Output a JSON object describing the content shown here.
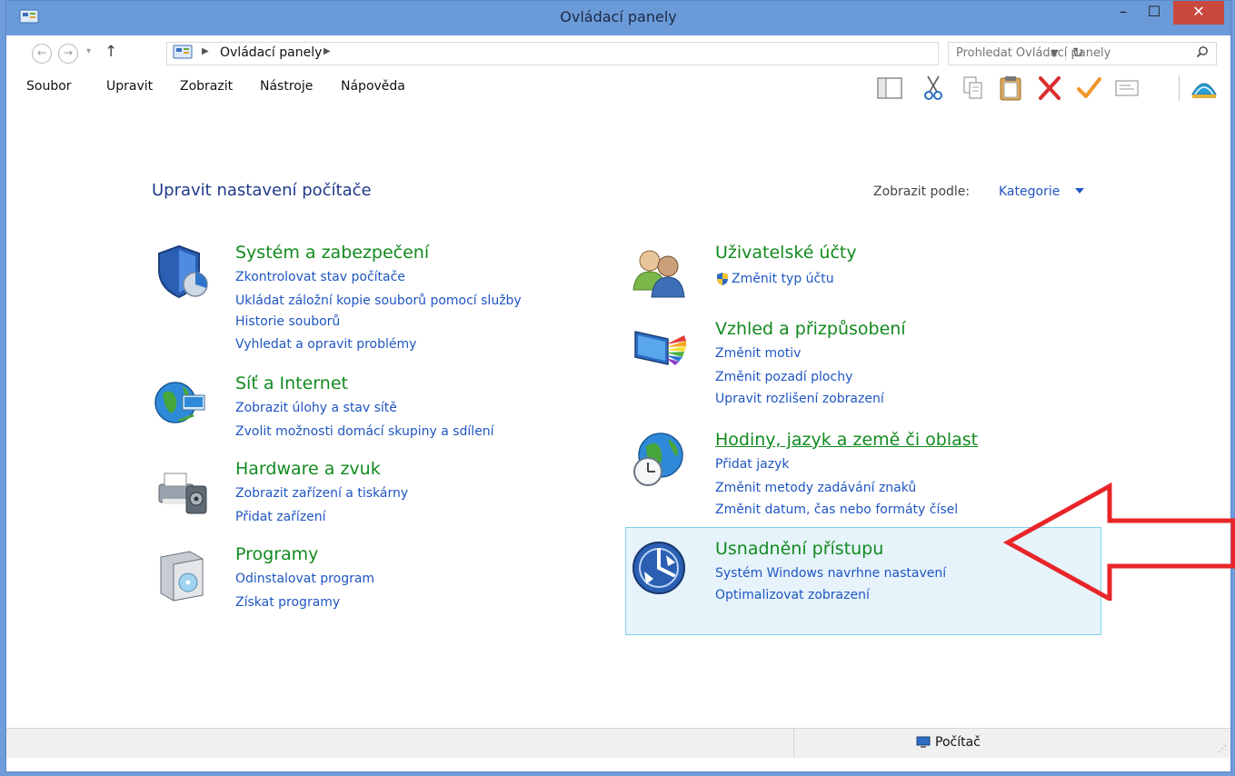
{
  "window": {
    "title": "Ovládací panely"
  },
  "titlebar": {
    "minimize_label": "–",
    "maximize_label": "☐",
    "close_label": "✕"
  },
  "address": {
    "crumb": "Ovládací panely",
    "search_placeholder": "Prohledat Ovládací panely"
  },
  "menu": [
    {
      "label": "Soubor"
    },
    {
      "label": "Upravit"
    },
    {
      "label": "Zobrazit"
    },
    {
      "label": "Nástroje"
    },
    {
      "label": "Nápověda"
    }
  ],
  "toolbar": {
    "icons": [
      "panel-layout-icon",
      "cut-icon",
      "copy-icon",
      "paste-icon",
      "delete-icon",
      "check-icon",
      "properties-icon",
      "classic-shell-icon"
    ]
  },
  "main": {
    "title": "Upravit nastavení počítače",
    "view_by_label": "Zobrazit podle:",
    "view_by_value": "Kategorie"
  },
  "categories": {
    "system": {
      "title": "Systém a zabezpečení",
      "links": [
        "Zkontrolovat stav počítače",
        "Ukládat záložní kopie souborů pomocí služby",
        "Historie souborů",
        "Vyhledat a opravit problémy"
      ]
    },
    "network": {
      "title": "Síť a Internet",
      "links": [
        "Zobrazit úlohy a stav sítě",
        "Zvolit možnosti domácí skupiny a sdílení"
      ]
    },
    "hardware": {
      "title": "Hardware a zvuk",
      "links": [
        "Zobrazit zařízení a tiskárny",
        "Přidat zařízení"
      ]
    },
    "programs": {
      "title": "Programy",
      "links": [
        "Odinstalovat program",
        "Získat programy"
      ]
    },
    "users": {
      "title": "Uživatelské účty",
      "links": [
        "Změnit typ účtu"
      ]
    },
    "appearance": {
      "title": "Vzhled a přizpůsobení",
      "links": [
        "Změnit motiv",
        "Změnit pozadí plochy",
        "Upravit rozlišení zobrazení"
      ]
    },
    "clock": {
      "title": "Hodiny, jazyk a země či oblast",
      "links": [
        "Přidat jazyk",
        "Změnit metody zadávání znaků",
        "Změnit datum, čas nebo formáty čísel"
      ]
    },
    "ease": {
      "title": "Usnadnění přístupu",
      "links": [
        "Systém Windows navrhne nastavení",
        "Optimalizovat zobrazení"
      ]
    }
  },
  "statusbar": {
    "location": "Počítač"
  },
  "colors": {
    "title_bar": "#6b9ad8",
    "link": "#1f56c1",
    "category_title": "#128a1e",
    "highlight": "#e6f3fb",
    "arrow": "#e8262a"
  }
}
